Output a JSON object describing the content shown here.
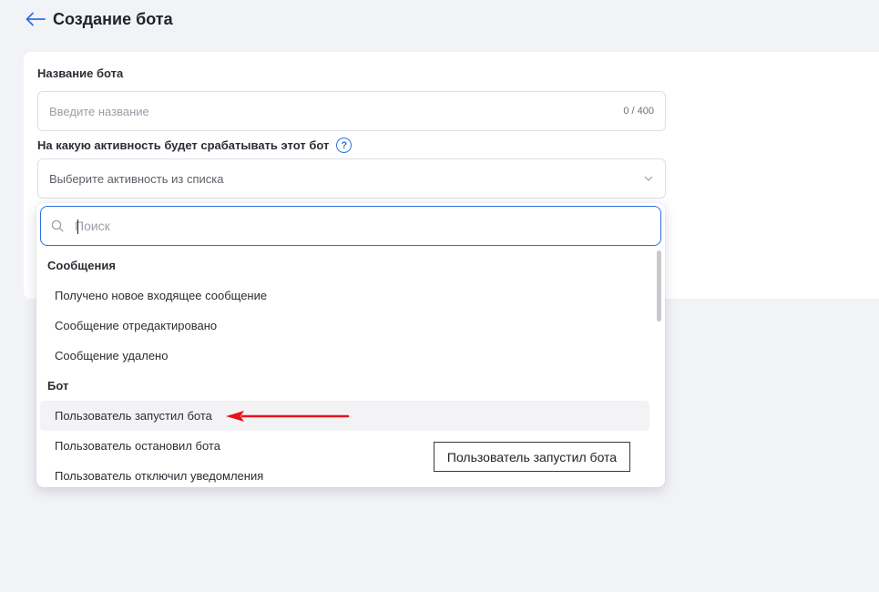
{
  "header": {
    "title": "Создание бота"
  },
  "form": {
    "name_label": "Название бота",
    "name_placeholder": "Введите название",
    "name_counter": "0 / 400",
    "activity_label": "На какую активность будет срабатывать этот бот",
    "help_glyph": "?",
    "activity_placeholder": "Выберите активность из списка"
  },
  "dropdown": {
    "search_placeholder": "Поиск",
    "groups": [
      {
        "title": "Сообщения",
        "options": [
          "Получено новое входящее сообщение",
          "Сообщение отредактировано",
          "Сообщение удалено"
        ]
      },
      {
        "title": "Бот",
        "options": [
          "Пользователь запустил бота",
          "Пользователь остановил бота",
          "Пользователь отключил уведомления"
        ]
      }
    ],
    "hovered_option": "Пользователь запустил бота"
  },
  "tooltip": {
    "text": "Пользователь запустил бота"
  },
  "colors": {
    "accent": "#2f6fe4",
    "annotation_arrow": "#e5141a",
    "background": "#f2f3f7"
  },
  "icons": {
    "back": "arrow-left-icon",
    "help": "question-circle-icon",
    "chevron": "chevron-down-icon",
    "search": "search-icon"
  }
}
